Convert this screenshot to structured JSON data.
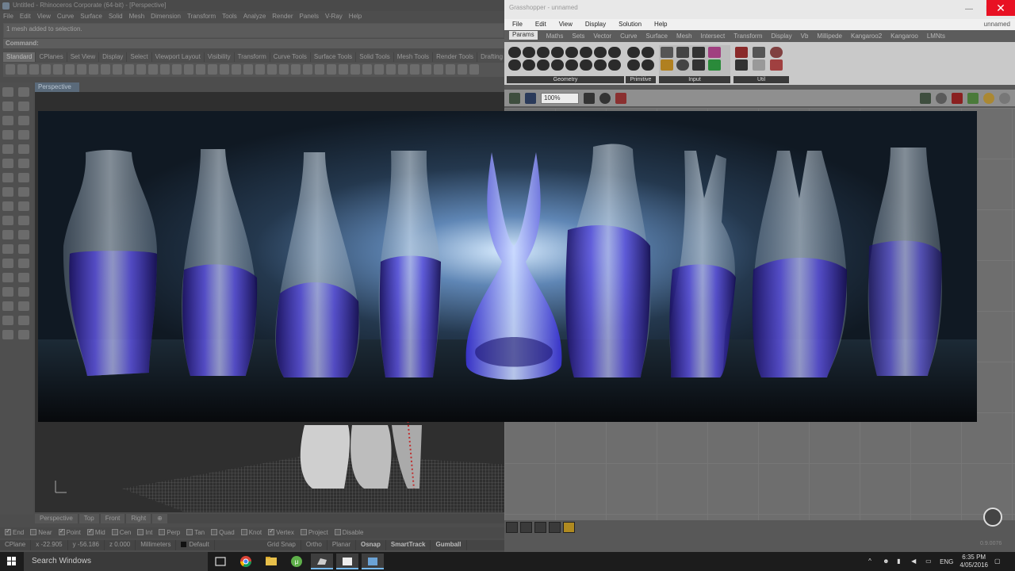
{
  "rhino": {
    "title": "Untitled - Rhinoceros Corporate (64-bit) - [Perspective]",
    "menu": [
      "File",
      "Edit",
      "View",
      "Curve",
      "Surface",
      "Solid",
      "Mesh",
      "Dimension",
      "Transform",
      "Tools",
      "Analyze",
      "Render",
      "Panels",
      "V-Ray",
      "Help"
    ],
    "command_history": "1 mesh added to selection.",
    "command_prompt": "Command:",
    "toolbar_tabs": [
      "Standard",
      "CPlanes",
      "Set View",
      "Display",
      "Select",
      "Viewport Layout",
      "Visibility",
      "Transform",
      "Curve Tools",
      "Surface Tools",
      "Solid Tools",
      "Mesh Tools",
      "Render Tools",
      "Drafting"
    ],
    "viewport_label": "Perspective",
    "viewport_tabs": [
      "Perspective",
      "Top",
      "Front",
      "Right"
    ],
    "osnaps": [
      {
        "label": "End",
        "checked": true
      },
      {
        "label": "Near",
        "checked": false
      },
      {
        "label": "Point",
        "checked": true
      },
      {
        "label": "Mid",
        "checked": true
      },
      {
        "label": "Cen",
        "checked": false
      },
      {
        "label": "Int",
        "checked": false
      },
      {
        "label": "Perp",
        "checked": false
      },
      {
        "label": "Tan",
        "checked": false
      },
      {
        "label": "Quad",
        "checked": false
      },
      {
        "label": "Knot",
        "checked": false
      },
      {
        "label": "Vertex",
        "checked": true
      },
      {
        "label": "Project",
        "checked": false
      },
      {
        "label": "Disable",
        "checked": false
      }
    ],
    "status": {
      "cplane": "CPlane",
      "x": "x -22.905",
      "y": "y -56.186",
      "z": "z 0.000",
      "units": "Millimeters",
      "layer": "Default",
      "grid_snap": "Grid Snap",
      "ortho": "Ortho",
      "planar": "Planar",
      "osnap": "Osnap",
      "smarttrack": "SmartTrack",
      "gumball": "Gumball"
    }
  },
  "grasshopper": {
    "title": "Grasshopper - unnamed",
    "menu": [
      "File",
      "Edit",
      "View",
      "Display",
      "Solution",
      "Help"
    ],
    "doc_name": "unnamed",
    "tabs": [
      "Params",
      "Maths",
      "Sets",
      "Vector",
      "Curve",
      "Surface",
      "Mesh",
      "Intersect",
      "Transform",
      "Display",
      "Vb",
      "Millipede",
      "Kangaroo2",
      "Kangaroo",
      "LMNts"
    ],
    "groups": [
      "Geometry",
      "Primitive",
      "Input",
      "Util"
    ],
    "zoom": "100%",
    "version": "0.9.0076"
  },
  "taskbar": {
    "search_placeholder": "Search Windows",
    "language": "ENG",
    "time": "6:35 PM",
    "date": "4/05/2016"
  },
  "colors": {
    "accent_blue": "#76b9ed",
    "close_red": "#e81123",
    "glass_purple": "#3c2fd0"
  }
}
